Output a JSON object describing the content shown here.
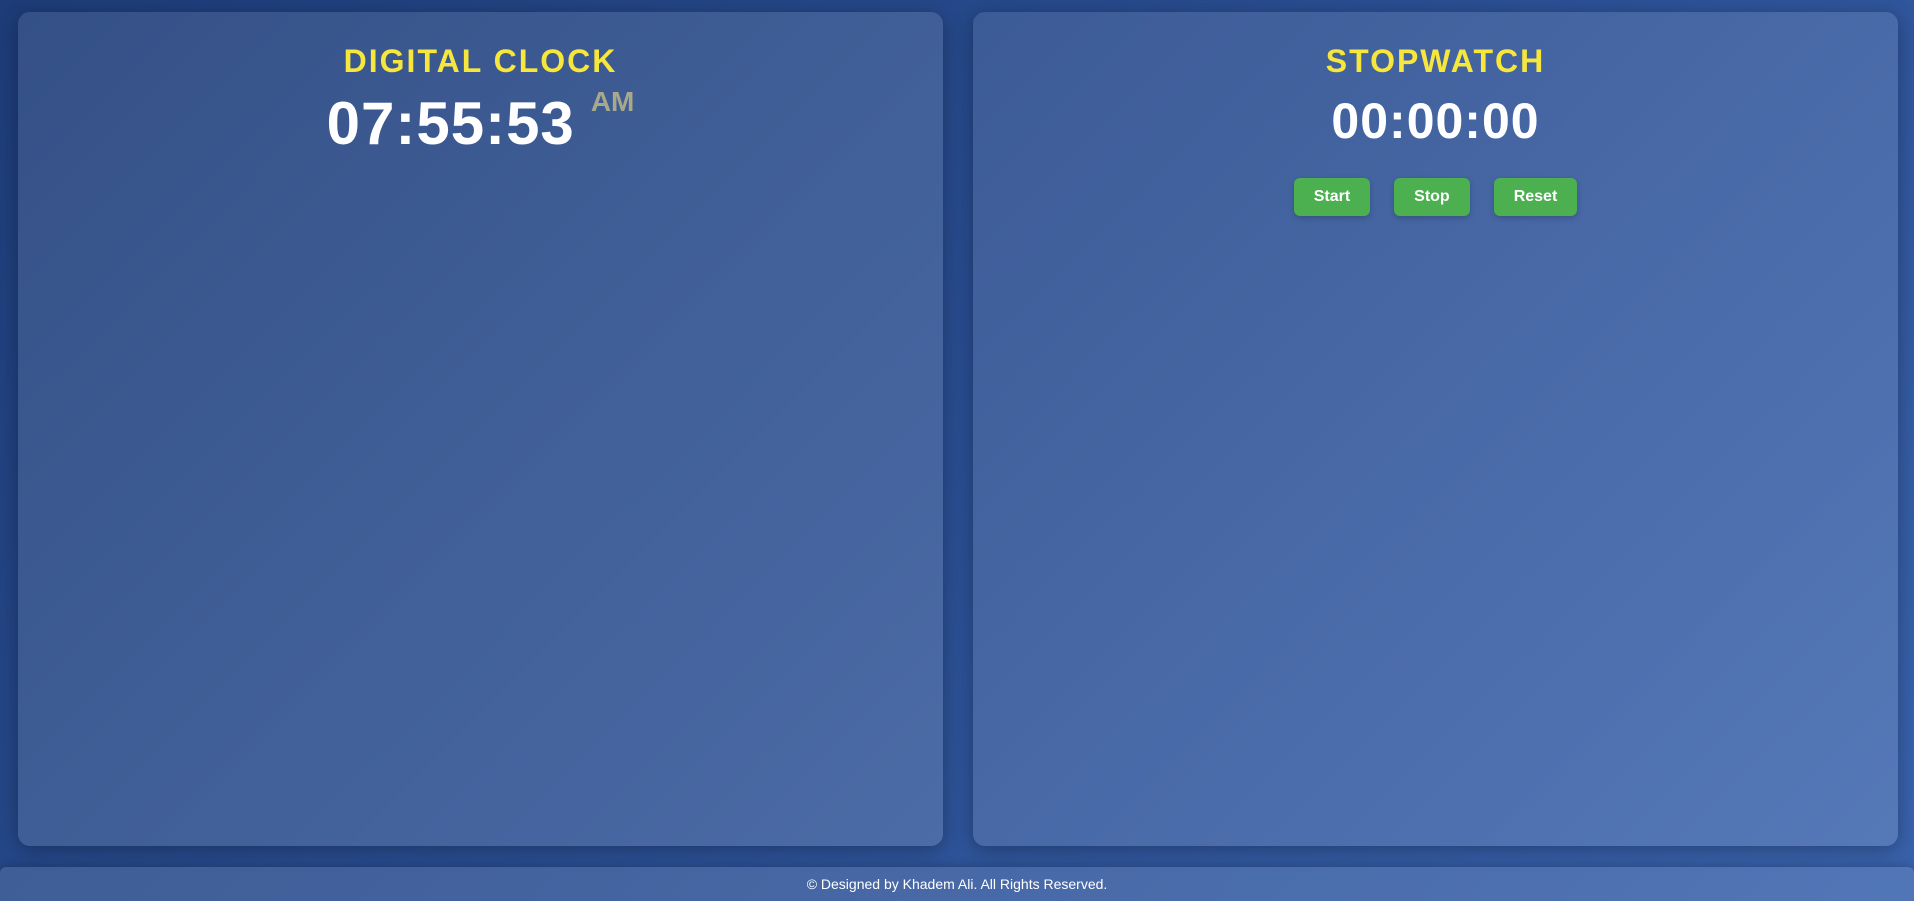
{
  "colors": {
    "title": "#f7e63b",
    "ampm": "#a8a88a",
    "button": "#4caf50"
  },
  "clock": {
    "title": "DIGITAL CLOCK",
    "time": "07:55:53",
    "ampm": "AM"
  },
  "stopwatch": {
    "title": "STOPWATCH",
    "time": "00:00:00",
    "buttons": {
      "start": "Start",
      "stop": "Stop",
      "reset": "Reset"
    }
  },
  "footer": {
    "text": "© Designed by Khadem Ali. All Rights Reserved."
  }
}
